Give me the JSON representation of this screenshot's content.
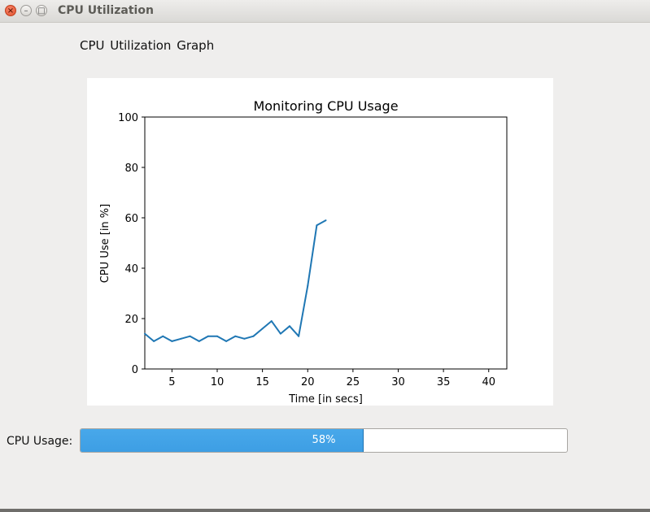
{
  "window": {
    "title": "CPU Utilization",
    "controls": {
      "close": "×",
      "minimize": "–",
      "maximize": "□"
    }
  },
  "heading": "CPU Utilization Graph",
  "chart_data": {
    "type": "line",
    "title": "Monitoring CPU Usage",
    "xlabel": "Time [in secs]",
    "ylabel": "CPU Use [in %]",
    "xlim": [
      2,
      42
    ],
    "ylim": [
      0,
      100
    ],
    "xticks": [
      5,
      10,
      15,
      20,
      25,
      30,
      35,
      40
    ],
    "yticks": [
      0,
      20,
      40,
      60,
      80,
      100
    ],
    "grid": false,
    "line_color": "#1f77b4",
    "series": [
      {
        "x": [
          2,
          3,
          4,
          5,
          6,
          7,
          8,
          9,
          10,
          11,
          12,
          13,
          14,
          15,
          16,
          17,
          18,
          19,
          20,
          21,
          22
        ],
        "values": [
          14,
          11,
          13,
          11,
          12,
          13,
          11,
          13,
          13,
          11,
          13,
          12,
          13,
          16,
          19,
          14,
          17,
          13,
          33,
          57,
          59
        ]
      }
    ]
  },
  "cpu_usage": {
    "label": "CPU Usage:",
    "value": 58,
    "text": "58%",
    "fill_color": "#3d9ee4"
  }
}
